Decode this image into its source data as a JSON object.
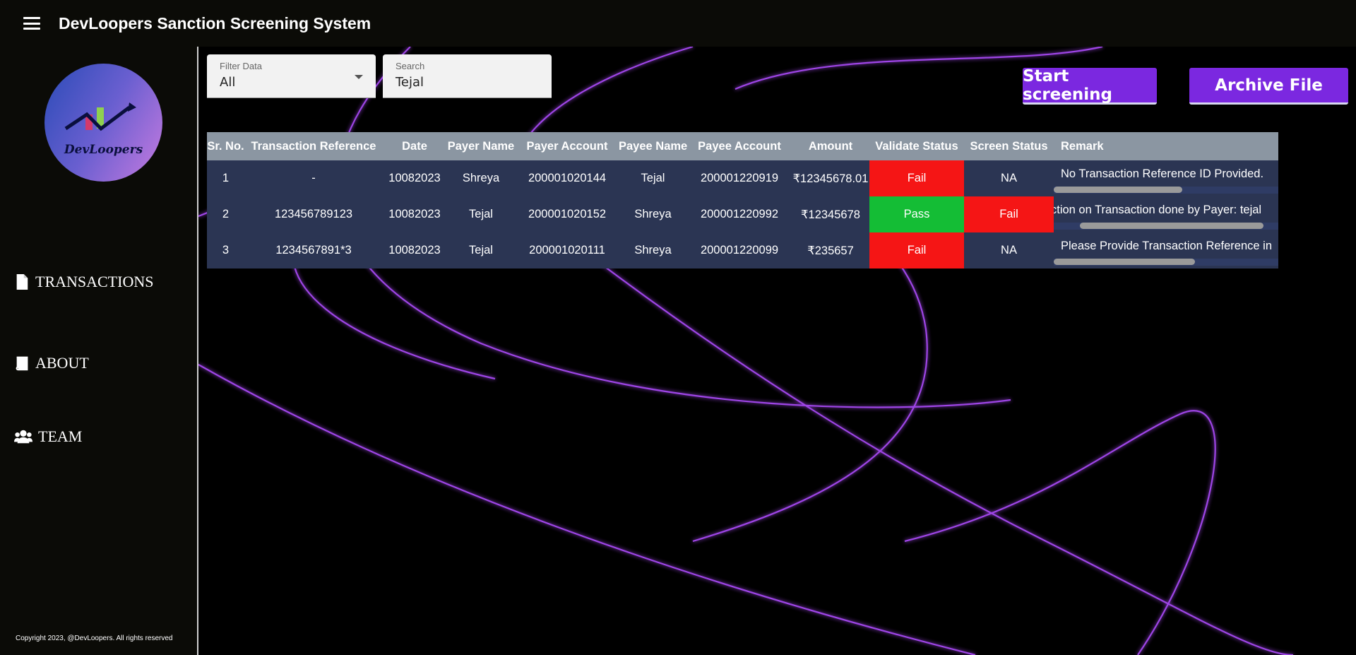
{
  "app": {
    "title": "DevLoopers Sanction Screening System"
  },
  "sidebar": {
    "logo_text": "DevLoopers",
    "items": [
      {
        "label": "TRANSACTIONS",
        "icon": "file-icon"
      },
      {
        "label": "ABOUT",
        "icon": "book-icon"
      },
      {
        "label": "TEAM",
        "icon": "users-icon"
      }
    ],
    "copyright": "Copyright 2023, @DevLoopers. All rights reserved"
  },
  "filters": {
    "filter": {
      "label": "Filter Data",
      "value": "All"
    },
    "search": {
      "label": "Search",
      "value": "Tejal"
    }
  },
  "actions": {
    "start": "Start screening",
    "archive": "Archive File"
  },
  "table": {
    "headers": [
      "Sr. No.",
      "Transaction Reference",
      "Date",
      "Payer Name",
      "Payer Account",
      "Payee Name",
      "Payee Account",
      "Amount",
      "Validate Status",
      "Screen Status",
      "Remark"
    ],
    "rows": [
      [
        "1",
        "-",
        "10082023",
        "Shreya",
        "200001020144",
        "Tejal",
        "200001220919",
        "₹12345678.01",
        "Fail",
        "NA",
        "No Transaction Reference ID Provided."
      ],
      [
        "2",
        "123456789123",
        "10082023",
        "Tejal",
        "200001020152",
        "Shreya",
        "200001220992",
        "₹12345678",
        "Pass",
        "Fail",
        "ction on Transaction done by Payer: tejal"
      ],
      [
        "3",
        "1234567891*3",
        "10082023",
        "Tejal",
        "200001020111",
        "Shreya",
        "200001220099",
        "₹235657",
        "Fail",
        "NA",
        "Please Provide Transaction Reference in"
      ]
    ]
  },
  "colors": {
    "accent": "#7b28e0",
    "pass": "#14bd35",
    "fail": "#f51515",
    "row_bg": "#2b3553",
    "header_bg": "#8b96a2"
  }
}
